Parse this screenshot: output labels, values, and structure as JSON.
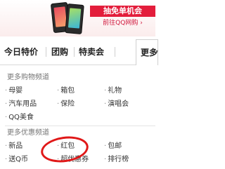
{
  "banner": {
    "title": "抽免单机会",
    "subtitle": "前往QQ网购 ›"
  },
  "nav": {
    "items": [
      "今日特价",
      "团购",
      "特卖会"
    ],
    "more_label": "更多"
  },
  "menu": {
    "section1": {
      "title": "更多购物频道",
      "items": [
        "母婴",
        "箱包",
        "礼物",
        "汽车用品",
        "保险",
        "演唱会",
        "QQ美食"
      ]
    },
    "section2": {
      "title": "更多优惠频道",
      "items": [
        "新品",
        "红包",
        "包邮",
        "送Q币",
        "超优惠券",
        "排行榜"
      ]
    }
  },
  "colors": {
    "accent": "#e31d3b",
    "annotation": "#e01818"
  }
}
